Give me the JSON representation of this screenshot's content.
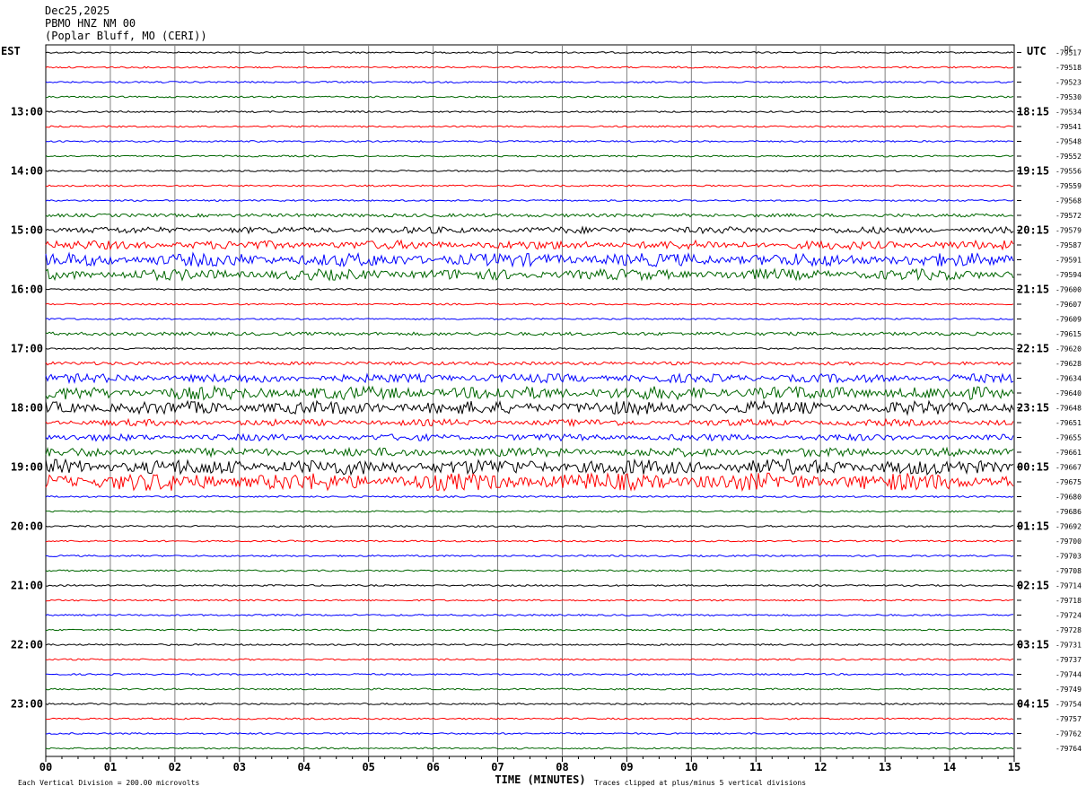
{
  "header": {
    "date": "Dec25,2025",
    "station": "PBMO HNZ NM 00",
    "location": "(Poplar Bluff, MO (CERI))"
  },
  "chart_data": {
    "type": "line",
    "left_timezone": "EST",
    "right_timezone": "UTC",
    "dc_label": "DC",
    "xlabel": "TIME (MINUTES)",
    "xticks": [
      "00",
      "01",
      "02",
      "03",
      "04",
      "05",
      "06",
      "07",
      "08",
      "09",
      "10",
      "11",
      "12",
      "13",
      "14",
      "15"
    ],
    "xlim": [
      0,
      15
    ],
    "est_hour_labels": [
      "13:00",
      "14:00",
      "15:00",
      "16:00",
      "17:00",
      "18:00",
      "19:00",
      "20:00",
      "21:00",
      "22:00",
      "23:00"
    ],
    "utc_hour_labels": [
      "18:15",
      "19:15",
      "20:15",
      "21:15",
      "22:15",
      "23:15",
      "00:15",
      "01:15",
      "02:15",
      "03:15",
      "04:15"
    ],
    "trace_colors": [
      "#000000",
      "#ff0000",
      "#0000ff",
      "#006600"
    ],
    "dc_offsets": [
      "-79517",
      "-79518",
      "-79523",
      "-79530",
      "-79534",
      "-79541",
      "-79548",
      "-79552",
      "-79556",
      "-79559",
      "-79568",
      "-79572",
      "-79579",
      "-79587",
      "-79591",
      "-79594",
      "-79600",
      "-79607",
      "-79609",
      "-79615",
      "-79620",
      "-79628",
      "-79634",
      "-79640",
      "-79648",
      "-79651",
      "-79655",
      "-79661",
      "-79667",
      "-79675",
      "-79680",
      "-79686",
      "-79692",
      "-79700",
      "-79703",
      "-79708",
      "-79714",
      "-79718",
      "-79724",
      "-79728",
      "-79731",
      "-79737",
      "-79744",
      "-79749",
      "-79754",
      "-79757",
      "-79762",
      "-79764"
    ],
    "trace_noise_level": [
      1,
      1,
      1,
      1,
      1,
      1,
      1,
      1,
      1,
      1,
      1,
      2,
      3,
      4,
      6,
      5,
      1,
      1,
      1,
      2,
      1,
      2,
      4,
      6,
      6,
      3,
      3,
      4,
      7,
      8,
      1,
      1,
      1,
      1,
      1,
      1,
      1,
      1,
      1,
      1,
      1,
      1,
      1,
      1,
      1,
      1,
      1,
      1
    ],
    "scale_note": "Each Vertical Division =  200.00 microvolts",
    "clip_note": "Traces clipped at plus/minus 5 vertical divisions"
  }
}
